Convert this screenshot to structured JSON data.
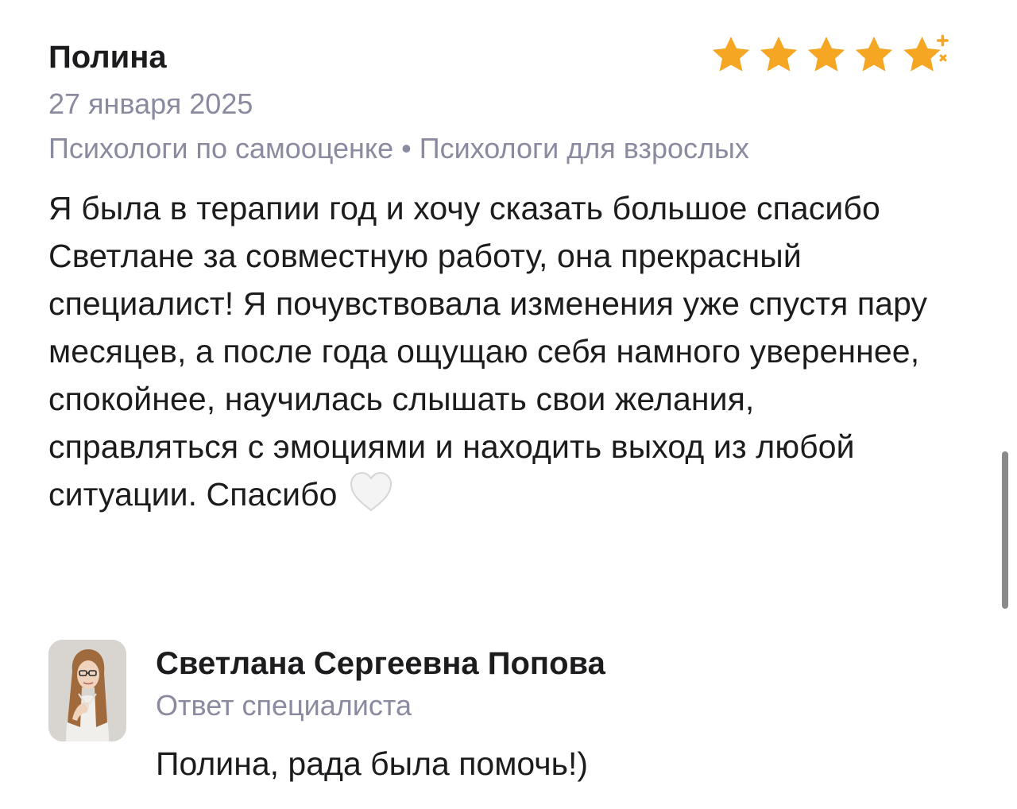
{
  "review": {
    "author": "Полина",
    "date": "27 января 2025",
    "tags": [
      "Психологи по самооценке",
      "Психологи для взрослых"
    ],
    "tag_separator": "•",
    "rating": 4.5,
    "rating_max": 5,
    "star_color": "#F5A623",
    "text": "Я была в терапии год и хочу сказать большое спасибо Светлане за совместную работу, она прекрасный специалист! Я почувствовала изменения уже спустя пару месяцев, а после года ощущаю себя намного увереннее, спокойнее, научилась слышать свои желания, справляться с эмоциями и находить выход из любой ситуации. Спасибо",
    "emoji": "white-heart-icon"
  },
  "reply": {
    "name": "Светлана Сергеевна Попова",
    "role": "Ответ специалиста",
    "text": "Полина, рада была помочь!)"
  }
}
